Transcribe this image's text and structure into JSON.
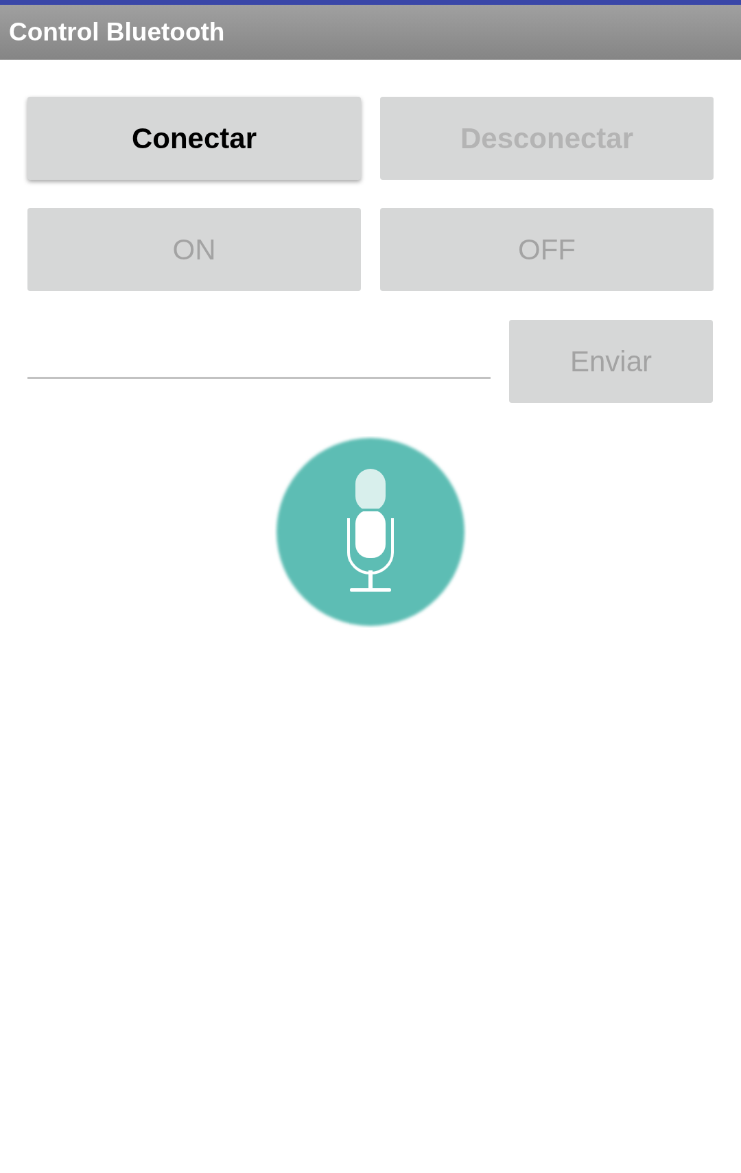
{
  "app_bar": {
    "title": "Control Bluetooth"
  },
  "button_rows": [
    [
      {
        "label": "Conectar",
        "kind": "bold",
        "disabled": false
      },
      {
        "label": "Desconectar",
        "kind": "bold",
        "disabled": true
      }
    ],
    [
      {
        "label": "ON",
        "kind": "regular",
        "disabled": true
      },
      {
        "label": "OFF",
        "kind": "regular",
        "disabled": true
      }
    ]
  ],
  "message": {
    "send_button": {
      "label": "Enviar",
      "disabled": true
    }
  }
}
